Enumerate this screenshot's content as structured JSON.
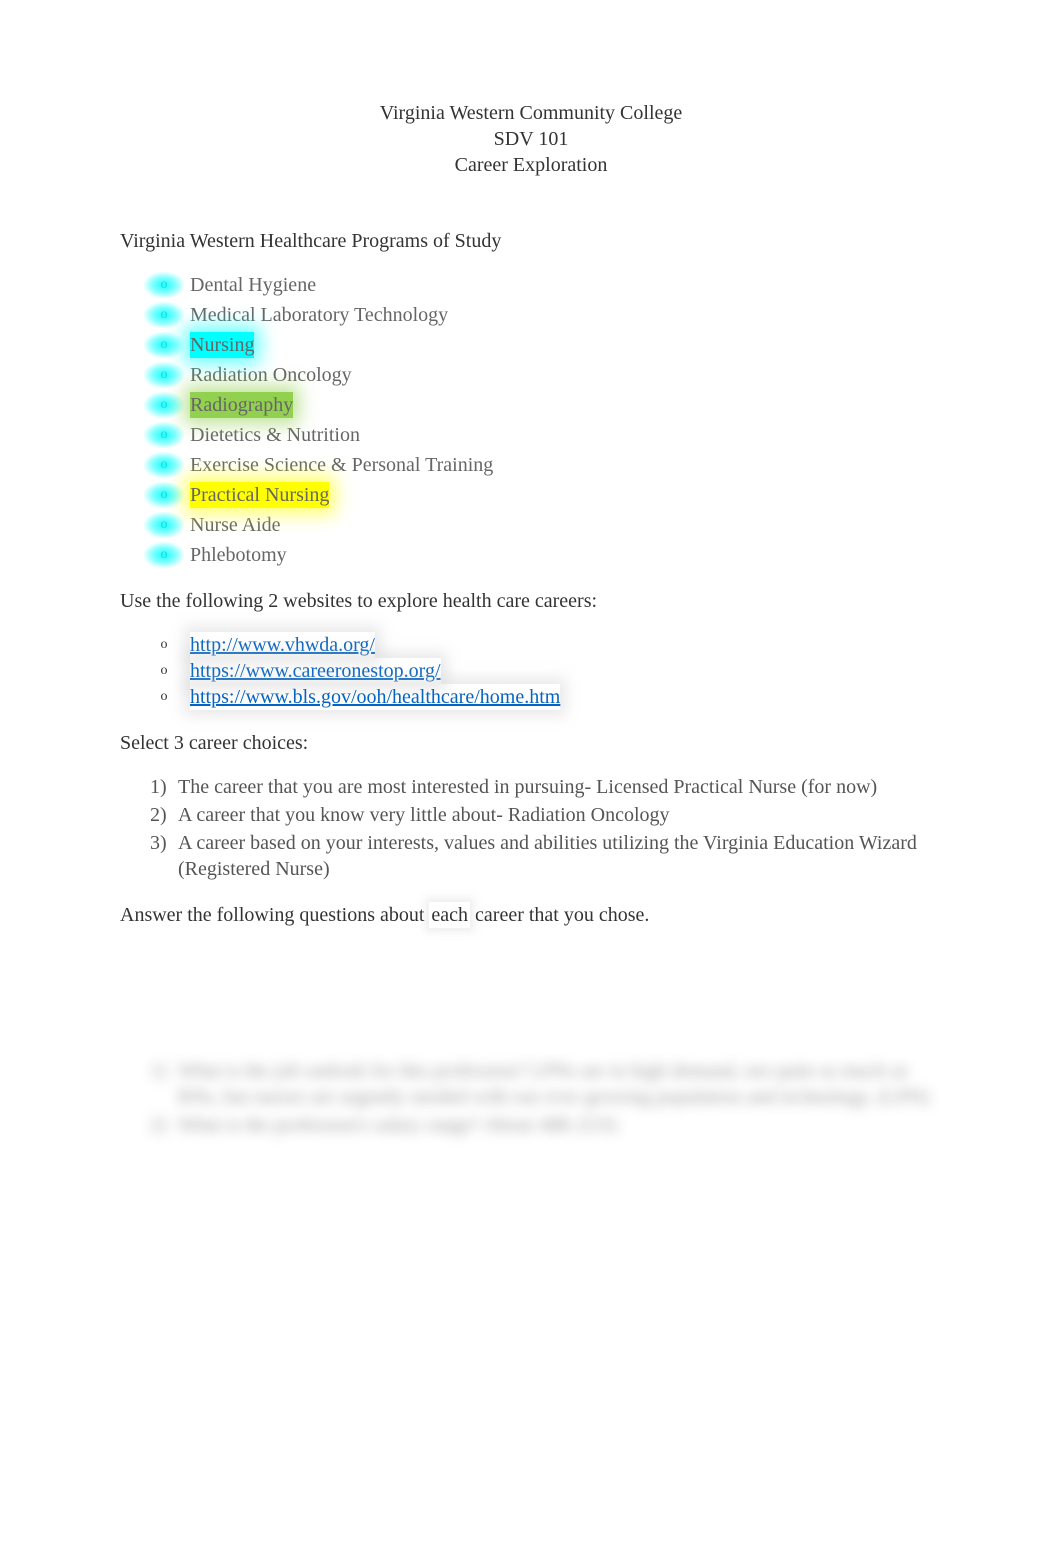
{
  "header": {
    "line1": "Virginia Western Community College",
    "line2": "SDV 101",
    "line3": "Career Exploration"
  },
  "section1_title": "Virginia Western Healthcare Programs of Study",
  "programs": [
    {
      "label": "Dental Hygiene",
      "highlight": "none"
    },
    {
      "label": "Medical Laboratory Technology",
      "highlight": "none"
    },
    {
      "label": "Nursing",
      "highlight": "cyan"
    },
    {
      "label": "Radiation Oncology",
      "highlight": "none"
    },
    {
      "label": "Radiography",
      "highlight": "green"
    },
    {
      "label": "Dietetics & Nutrition",
      "highlight": "none"
    },
    {
      "label": "Exercise Science & Personal Training",
      "highlight": "none"
    },
    {
      "label": "Practical Nursing",
      "highlight": "yellow"
    },
    {
      "label": "Nurse Aide",
      "highlight": "none"
    },
    {
      "label": "Phlebotomy",
      "highlight": "none"
    }
  ],
  "section2_title": "Use the following 2 websites to explore health care careers:",
  "links": [
    {
      "url": "http://www.vhwda.org/"
    },
    {
      "url": "https://www.careeronestop.org/"
    },
    {
      "url": "https://www.bls.gov/ooh/healthcare/home.htm"
    }
  ],
  "section3_title": "Select 3 career choices:",
  "career_choices": [
    {
      "marker": "1)",
      "text": "The career that you are most interested in pursuing- Licensed Practical Nurse (for now)"
    },
    {
      "marker": "2)",
      "text": "A career that you know very little about- Radiation Oncology"
    },
    {
      "marker": "3)",
      "text": "A career based on your interests, values and abilities utilizing the Virginia Education Wizard (Registered Nurse)"
    }
  ],
  "instruction_prefix": "Answer the following questions about ",
  "instruction_each": "each",
  "instruction_suffix": " career that you chose.",
  "blurred_items": [
    {
      "marker": "1)",
      "text": "What is the job outlook for this profession? LPNs are in high demand, not quite as much as RNs, but nurses are urgently needed with our ever growing population and technology. (LPN)"
    },
    {
      "marker": "2)",
      "text": "What is the profession's salary range? About 48K (US)"
    }
  ],
  "bullet_char": "o"
}
